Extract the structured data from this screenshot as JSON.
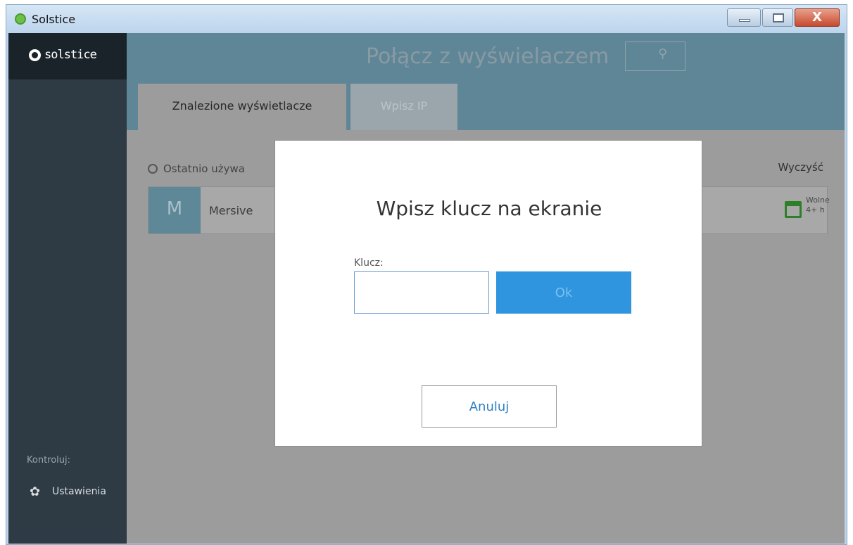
{
  "window": {
    "title": "Solstice",
    "min_label": "",
    "max_label": "",
    "close_label": "X",
    "accent_close": "#c74a2e"
  },
  "sidebar": {
    "logo_text": "solstice",
    "section_label": "Kontroluj:",
    "settings_label": "Ustawienia",
    "settings_icon": "gear-icon"
  },
  "header": {
    "title": "Połącz z wyświelaczem",
    "search_icon": "search-icon",
    "color": "#5f8696"
  },
  "tabs": [
    {
      "label": "Znalezione wyświetlacze",
      "active": true
    },
    {
      "label": "Wpisz IP",
      "active": false
    }
  ],
  "recent": {
    "label": "Ostatnio używa",
    "clear_label": "Wyczyść",
    "display": {
      "initial": "M",
      "name": "Mersive",
      "status_line1": "Wolne",
      "status_line2": "4+ h",
      "status_color": "#2d7f2a"
    }
  },
  "modal": {
    "title": "Wpisz klucz na ekranie",
    "key_label": "Klucz:",
    "key_value": "",
    "ok_label": "Ok",
    "cancel_label": "Anuluj",
    "ok_color": "#2f95de"
  }
}
